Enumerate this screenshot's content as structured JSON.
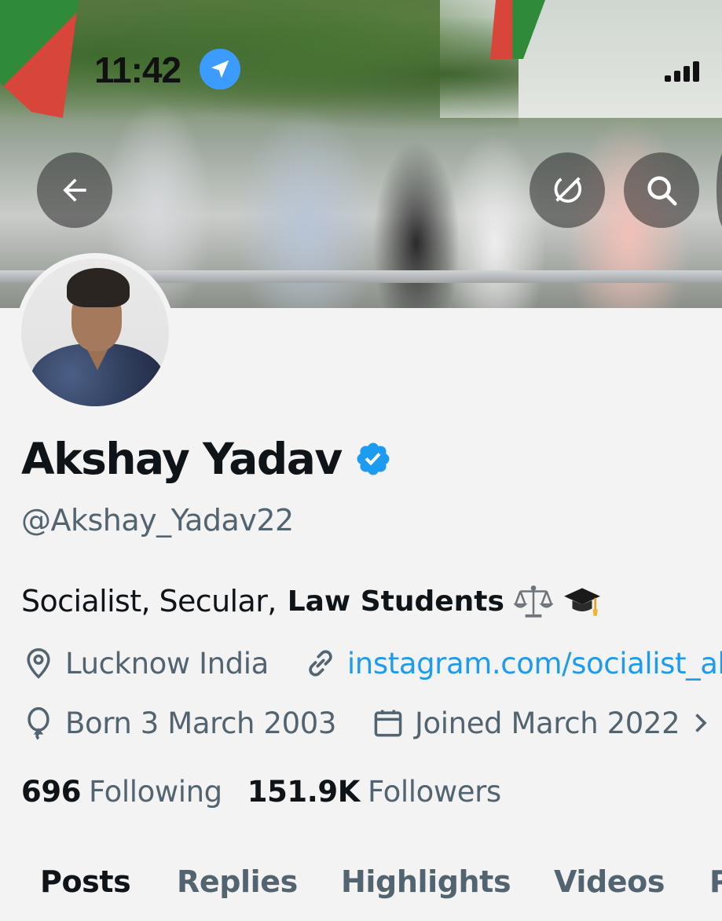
{
  "status_bar": {
    "time": "11:42"
  },
  "header": {
    "back_icon": "arrow-left-icon",
    "grok_icon": "grok-icon",
    "search_icon": "search-icon",
    "more_icon": "more-icon"
  },
  "profile": {
    "display_name": "Akshay Yadav",
    "verified": true,
    "verified_color": "#1d9bf0",
    "handle": "@Akshay_Yadav22",
    "bio_plain": "Socialist, Secular,",
    "bio_bold": "Law Students",
    "bio_emojis": [
      "balance-scale-emoji",
      "graduation-cap-emoji"
    ],
    "location": "Lucknow India",
    "website": "instagram.com/socialist_ak",
    "birth": "Born 3 March 2003",
    "joined": "Joined March 2022",
    "following_count": "696",
    "following_label": "Following",
    "followers_count": "151.9K",
    "followers_label": "Followers"
  },
  "tabs": [
    {
      "label": "Posts",
      "active": true
    },
    {
      "label": "Replies",
      "active": false
    },
    {
      "label": "Highlights",
      "active": false
    },
    {
      "label": "Videos",
      "active": false
    },
    {
      "label": "P",
      "active": false
    }
  ],
  "colors": {
    "text_primary": "#0f1419",
    "text_secondary": "#536471",
    "link": "#1d9bf0",
    "background": "#f3f3f3"
  }
}
